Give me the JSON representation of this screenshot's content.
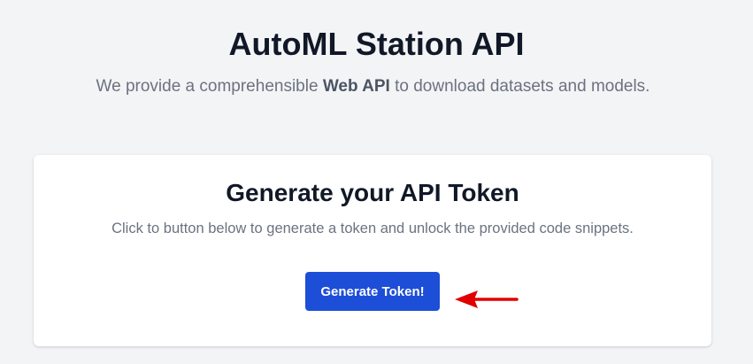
{
  "hero": {
    "title": "AutoML Station API",
    "subtitle_before": "We provide a comprehensible ",
    "subtitle_bold": "Web API",
    "subtitle_after": " to download datasets and models."
  },
  "card": {
    "title": "Generate your API Token",
    "description": "Click to button below to generate a token and unlock the provided code snippets.",
    "button_label": "Generate Token!"
  },
  "colors": {
    "background": "#f3f4f6",
    "button": "#1d4ed8",
    "annotation_arrow": "#e00000"
  },
  "icons": {
    "annotation": "arrow-left-icon"
  }
}
